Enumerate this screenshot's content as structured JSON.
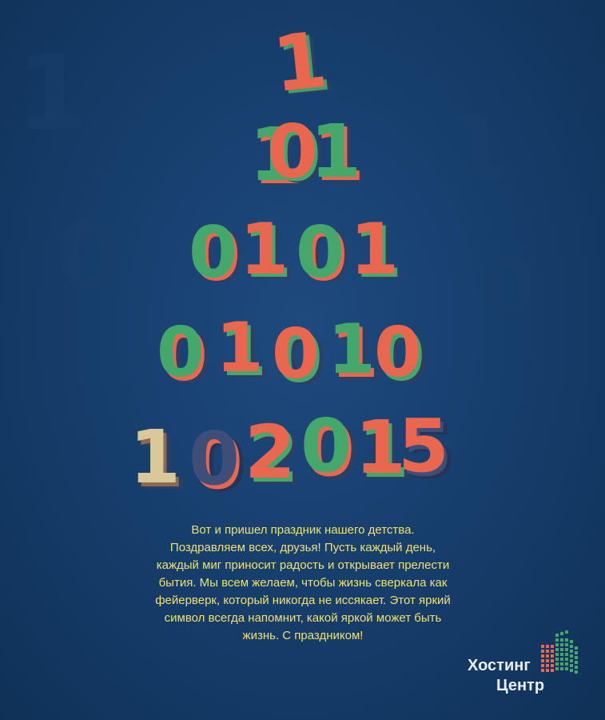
{
  "tree_rows": [
    {
      "digits": [
        "1"
      ]
    },
    {
      "digits": [
        "1",
        "0",
        "1"
      ]
    },
    {
      "digits": [
        "0",
        "1",
        "0",
        "1"
      ]
    },
    {
      "digits": [
        "0",
        "1",
        "0",
        "1",
        "0"
      ]
    },
    {
      "digits": [
        "1",
        "0",
        "2",
        "0",
        "1",
        "5"
      ]
    }
  ],
  "message_lines": [
    "Вот и пришел праздник нашего детства.",
    "Поздравляем всех, друзья! Пусть каждый день,",
    "каждый миг приносит радость и открывает прелести",
    "бытия. Мы всем желаем, чтобы жизнь сверкала как",
    "фейерверк, который никогда не иссякает. Этот яркий",
    "символ всегда напомнит, какой яркой может быть",
    "жизнь. С праздником!"
  ],
  "brand": {
    "line1": "Хостинг",
    "line2": "Центр"
  },
  "colors": {
    "background": "#173f6e",
    "digit_red": "#e8674e",
    "digit_green": "#45a86b",
    "digit_side": "#2e3f66",
    "message_text": "#f2e06a"
  }
}
